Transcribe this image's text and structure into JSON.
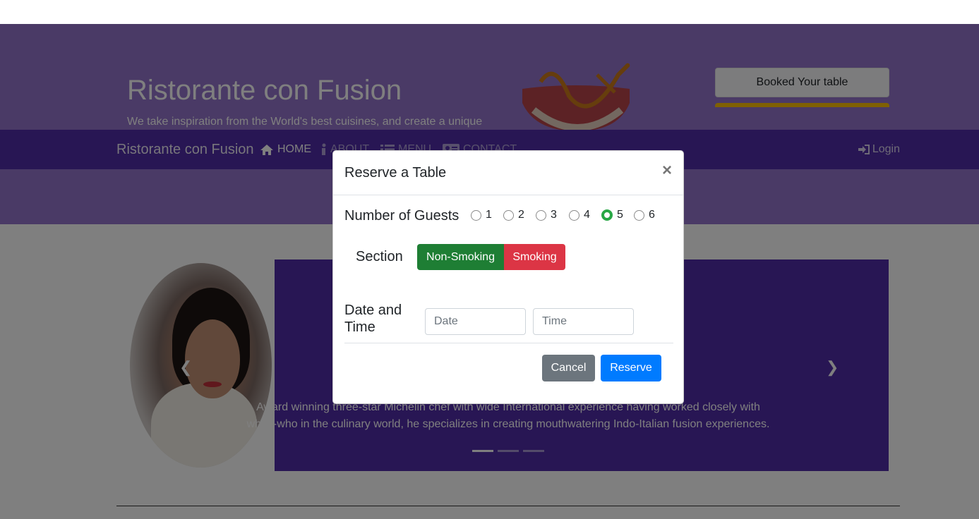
{
  "header": {
    "title": "Ristorante con Fusion",
    "subtitle": "We take inspiration from the World's best cuisines, and create a unique",
    "booked_button": "Booked Your table"
  },
  "navbar": {
    "brand": "Ristorante con Fusion",
    "items": [
      {
        "label": "HOME",
        "icon": "home-icon",
        "active": true
      },
      {
        "label": "ABOUT",
        "icon": "info-icon",
        "active": false
      },
      {
        "label": "MENU",
        "icon": "list-icon",
        "active": false
      },
      {
        "label": "CONTACT",
        "icon": "address-card-icon",
        "active": false
      }
    ],
    "login": "Login"
  },
  "carousel": {
    "caption": "Award winning three-star Michelin chef with wide International experience having worked closely with whos-who in the culinary world, he specializes in creating mouthwatering Indo-Italian fusion experiences.",
    "slide_count": 3,
    "active_slide": 1
  },
  "modal": {
    "title": "Reserve a Table",
    "close": "×",
    "guests_label": "Number of Guests",
    "guests": [
      "1",
      "2",
      "3",
      "4",
      "5",
      "6"
    ],
    "guests_selected": "5",
    "section_label": "Section",
    "section_options": [
      "Non-Smoking",
      "Smoking"
    ],
    "datetime_label_1": "Date and",
    "datetime_label_2": "Time",
    "date_placeholder": "Date",
    "time_placeholder": "Time",
    "cancel": "Cancel",
    "reserve": "Reserve"
  },
  "colors": {
    "primary_dark": "#512da8",
    "primary_light": "#9575cd",
    "success": "#28a745",
    "danger": "#dc3545",
    "blue": "#007bff"
  }
}
